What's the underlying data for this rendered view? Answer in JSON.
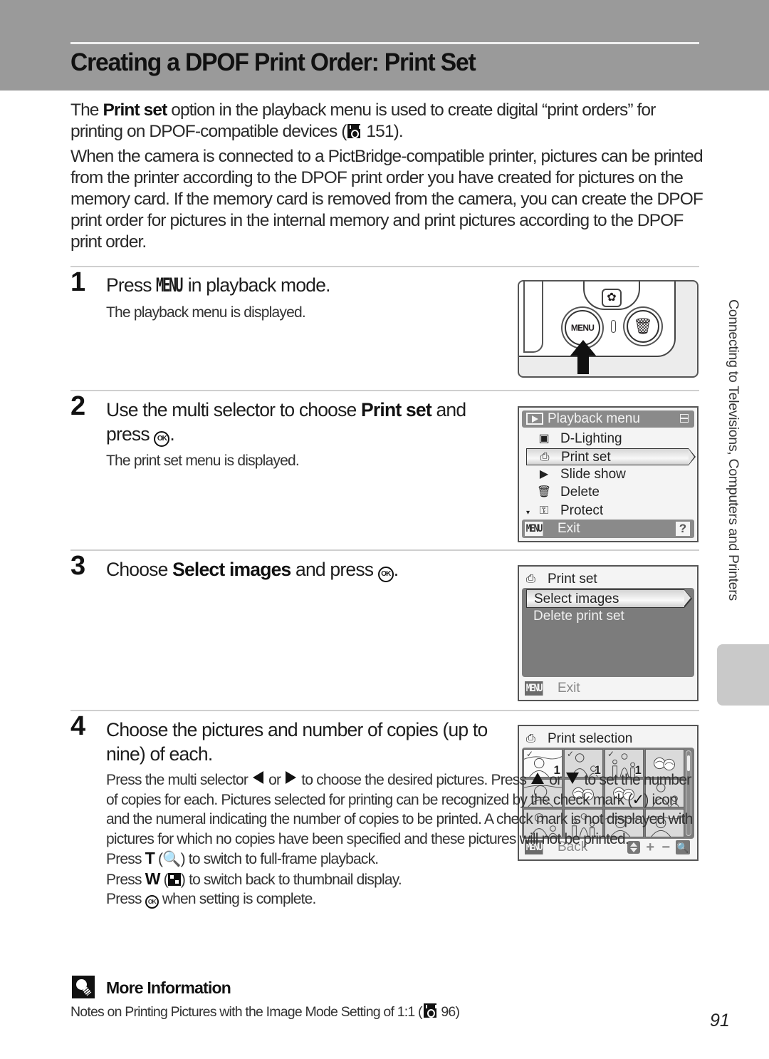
{
  "header": {
    "title": "Creating a DPOF Print Order: Print Set"
  },
  "intro": {
    "p1_before": "The ",
    "p1_bold": "Print set",
    "p1_after": " option in the playback menu is used to create digital “print orders” for printing on DPOF-compatible devices (",
    "p1_ref": "151",
    "p1_end": ").",
    "p2": "When the camera is connected to a PictBridge-compatible printer, pictures can be printed from the printer according to the DPOF print order you have created for pictures on the memory card. If the memory card is removed from the camera, you can create the DPOF print order for pictures in the internal memory and print pictures according to the DPOF print order."
  },
  "steps": [
    {
      "number": "1",
      "title_before": "Press ",
      "title_key": "MENU",
      "title_after": " in playback mode.",
      "sub": "The playback menu is displayed."
    },
    {
      "number": "2",
      "title_before": "Use the multi selector to choose ",
      "title_bold": "Print set",
      "title_after": " and press ",
      "title_key": "OK",
      "title_end": ".",
      "sub": "The print set menu is displayed."
    },
    {
      "number": "3",
      "title_before": "Choose ",
      "title_bold": "Select images",
      "title_after": " and press ",
      "title_key": "OK",
      "title_end": "."
    },
    {
      "number": "4",
      "title": "Choose the pictures and number of copies (up to nine) of each.",
      "body": {
        "l1a": "Press the multi selector ",
        "l1b": " or ",
        "l1c": " to choose the desired pictures. Press ",
        "l1d": " or ",
        "l1e": " to set the number of copies for each. Pictures selected for printing can be recognized by the check mark (",
        "check_glyph": "✓",
        "l1f": ") icon and the numeral indicating the number of copies to be printed. A check mark is not displayed with pictures for which no copies have been specified and these pictures will not be printed.",
        "t_before": "Press ",
        "t_key": "T",
        "t_paren_open": " (",
        "t_glyph": "🔍",
        "t_after": ") to switch to full-frame playback.",
        "w_before": "Press ",
        "w_key": "W",
        "w_paren_open": " (",
        "w_after": ") to switch back to thumbnail display.",
        "ok_before": "Press ",
        "ok_key": "OK",
        "ok_after": " when setting is complete."
      }
    }
  ],
  "camera_illustration": {
    "menu_button_label": "MENU",
    "flower_icon": "✿",
    "trash_icon": "🗑"
  },
  "playback_menu_screen": {
    "title": "Playback menu",
    "items": [
      {
        "icon": "d-lighting-icon",
        "glyph": "▣",
        "label": "D-Lighting",
        "selected": false
      },
      {
        "icon": "print-set-icon",
        "glyph": "⎙",
        "label": "Print set",
        "selected": true
      },
      {
        "icon": "slide-show-icon",
        "glyph": "▶",
        "label": "Slide show",
        "selected": false
      },
      {
        "icon": "delete-icon",
        "glyph": "🗑",
        "label": "Delete",
        "selected": false
      },
      {
        "icon": "protect-icon",
        "glyph": "⚿",
        "label": "Protect",
        "selected": false
      }
    ],
    "footer_menu": "MENU",
    "footer_label": "Exit",
    "help": "?"
  },
  "print_set_screen": {
    "title": "Print set",
    "items": [
      {
        "label": "Select images",
        "selected": true
      },
      {
        "label": "Delete print set",
        "selected": false
      }
    ],
    "footer_menu": "MENU",
    "footer_label": "Exit"
  },
  "print_selection_screen": {
    "title": "Print selection",
    "thumbnails": [
      {
        "scene": "woman-landscape",
        "checked": true,
        "copies": "1",
        "active": true
      },
      {
        "scene": "woman-child",
        "checked": true,
        "copies": "1",
        "active": false
      },
      {
        "scene": "family",
        "checked": true,
        "copies": "1",
        "active": false
      },
      {
        "scene": "flowers",
        "checked": false,
        "copies": "",
        "active": false
      },
      {
        "scene": "woman-portrait",
        "checked": false,
        "copies": "",
        "active": false
      },
      {
        "scene": "flowers",
        "checked": false,
        "copies": "",
        "active": false
      },
      {
        "scene": "flowers",
        "checked": false,
        "copies": "",
        "active": false
      },
      {
        "scene": "woman-child",
        "checked": false,
        "copies": "",
        "active": false
      },
      {
        "scene": "woman-child",
        "checked": false,
        "copies": "",
        "active": false
      },
      {
        "scene": "family",
        "checked": false,
        "copies": "",
        "active": false
      },
      {
        "scene": "woman-landscape",
        "checked": false,
        "copies": "",
        "active": false
      },
      {
        "scene": "woman-landscape",
        "checked": false,
        "copies": "",
        "active": false
      }
    ],
    "footer_menu": "MENU",
    "footer_label": "Back",
    "plus": "+",
    "minus": "−",
    "zoom_glyph": "🔍"
  },
  "more_info": {
    "title": "More Information",
    "text_before": "Notes on Printing Pictures with the Image Mode Setting of 1:1 (",
    "ref": "96",
    "text_after": ")"
  },
  "side_label": "Connecting to Televisions, Computers and Printers",
  "page_number": "91"
}
